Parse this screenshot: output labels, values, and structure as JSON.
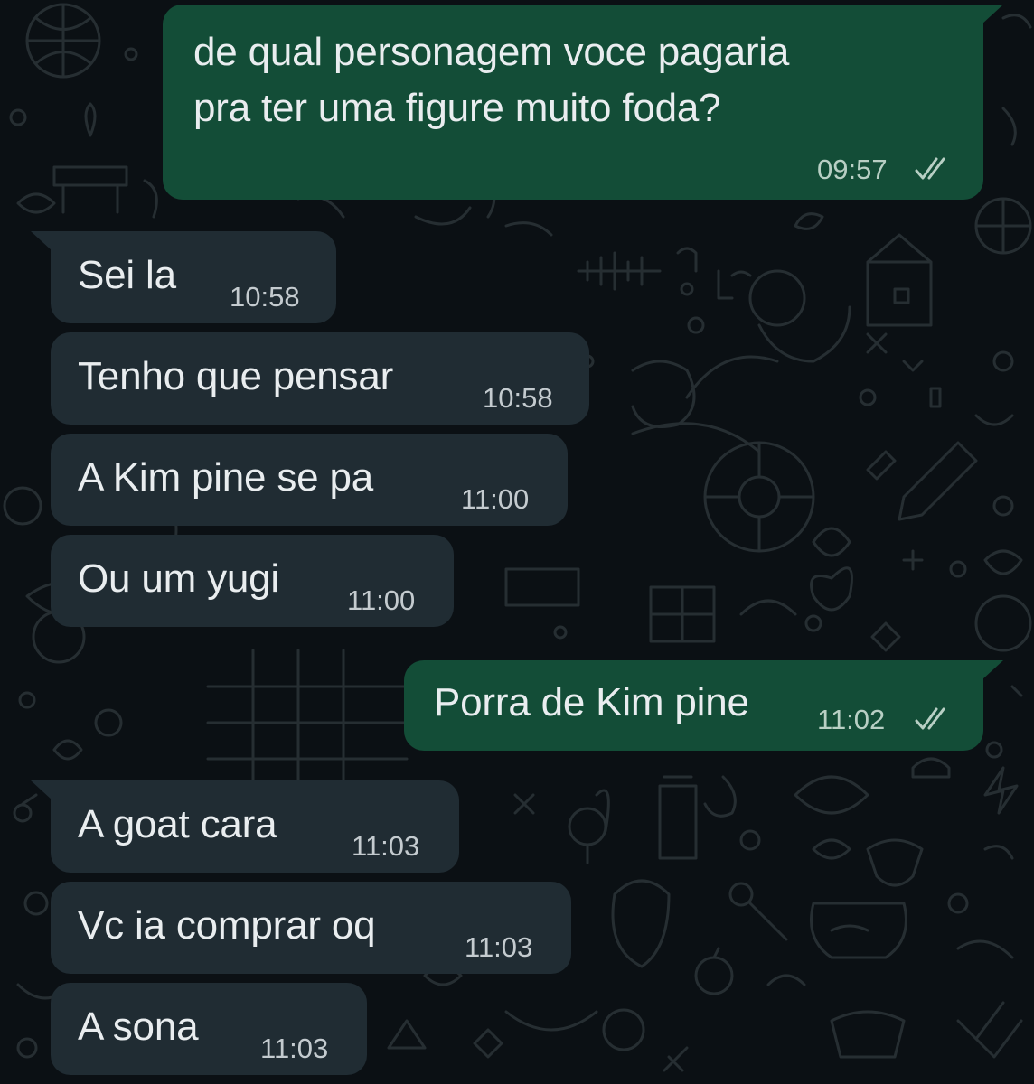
{
  "conversation": {
    "messages": [
      {
        "direction": "outgoing",
        "text_line1": "de qual personagem voce pagaria",
        "text_line2": "pra ter uma figure muito foda?",
        "time": "09:57",
        "status_icon": "double-check-icon"
      },
      {
        "direction": "incoming",
        "text": "Sei la",
        "time": "10:58"
      },
      {
        "direction": "incoming",
        "text": "Tenho que pensar",
        "time": "10:58"
      },
      {
        "direction": "incoming",
        "text": "A Kim pine se pa",
        "time": "11:00"
      },
      {
        "direction": "incoming",
        "text": "Ou um yugi",
        "time": "11:00"
      },
      {
        "direction": "outgoing",
        "text": "Porra de Kim pine",
        "time": "11:02",
        "status_icon": "double-check-icon"
      },
      {
        "direction": "incoming",
        "text": "A goat cara",
        "time": "11:03"
      },
      {
        "direction": "incoming",
        "text": "Vc ia comprar oq",
        "time": "11:03"
      },
      {
        "direction": "incoming",
        "text": "A sona",
        "time": "11:03"
      }
    ]
  },
  "colors": {
    "background": "#0b1014",
    "incoming_bubble": "#202c33",
    "outgoing_bubble": "#134d37",
    "text": "#e9edef",
    "timestamp": "#c4cbcf"
  }
}
